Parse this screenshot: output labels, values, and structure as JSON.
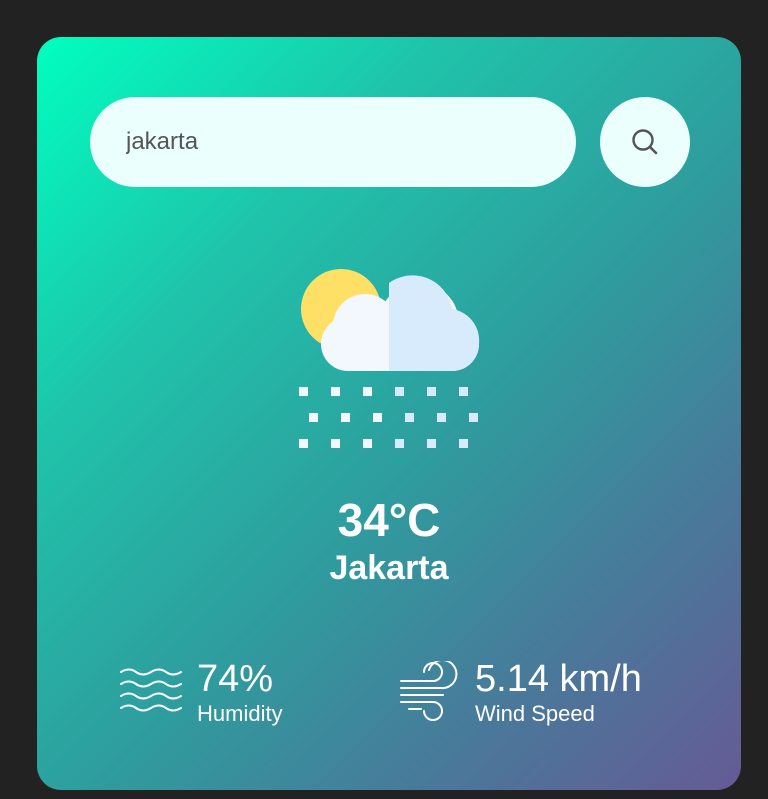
{
  "search": {
    "value": "jakarta",
    "placeholder": "",
    "button_icon": "search-icon"
  },
  "weather": {
    "icon": "snow-cloud-sun-icon",
    "temperature": "34°C",
    "city": "Jakarta"
  },
  "details": {
    "humidity": {
      "icon": "humidity-waves-icon",
      "value": "74%",
      "label": "Humidity"
    },
    "wind": {
      "icon": "wind-icon",
      "value": "5.14 km/h",
      "label": "Wind Speed"
    }
  },
  "colors": {
    "gradient_start": "#00ffc0",
    "gradient_end": "#665a96",
    "input_background": "#ebfffc",
    "page_background": "#222222",
    "text": "#ffffff"
  }
}
